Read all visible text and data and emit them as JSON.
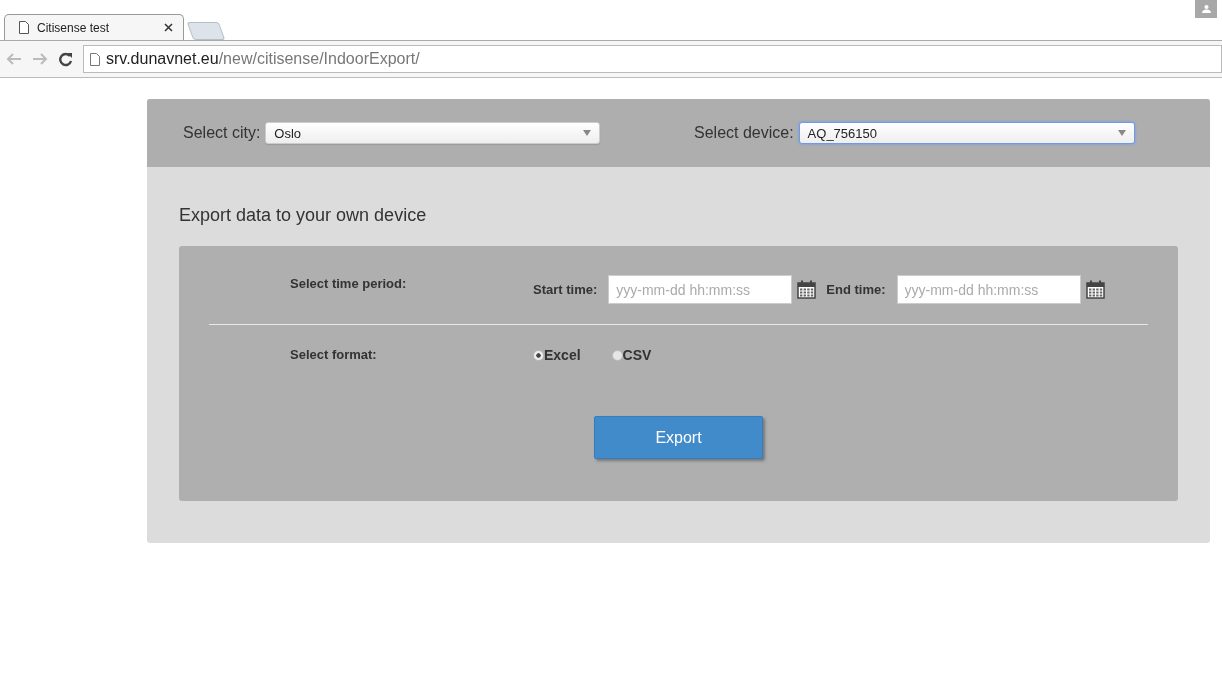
{
  "browser": {
    "tabs": [
      {
        "title": "Citisense test",
        "selected": true
      }
    ],
    "url_host": "srv.dunavnet.eu",
    "url_path": "/new/citisense/IndoorExport/"
  },
  "filters": [
    {
      "label": "Select city:",
      "value": "Oslo",
      "focused": false
    },
    {
      "label": "Select device:",
      "value": "AQ_756150",
      "focused": true
    }
  ],
  "heading": "Export data to your own device",
  "time_period": {
    "label": "Select time period:",
    "fields": [
      {
        "label": "Start time:",
        "placeholder": "yyy-mm-dd hh:mm:ss"
      },
      {
        "label": "End time:",
        "placeholder": "yyy-mm-dd hh:mm:ss"
      }
    ]
  },
  "format": {
    "label": "Select format:",
    "options": [
      {
        "label": "Excel",
        "selected": true
      },
      {
        "label": "CSV",
        "selected": false
      }
    ]
  },
  "export_button": "Export"
}
